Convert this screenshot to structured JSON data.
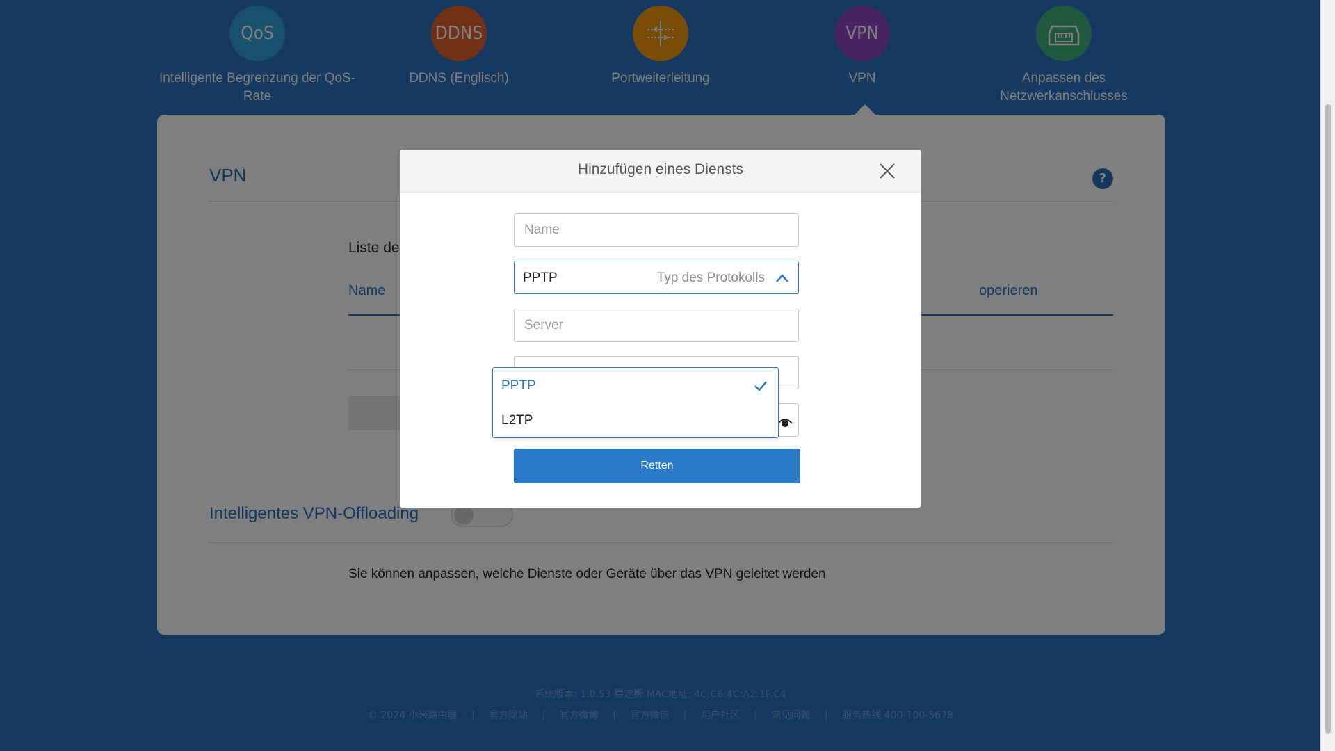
{
  "features": [
    {
      "icon_text": "QoS",
      "label": "Intelligente Begrenzung der QoS-Rate",
      "color": "#2fa3d6"
    },
    {
      "icon_text": "DDNS",
      "label": "DDNS (Englisch)",
      "color": "#e2622c"
    },
    {
      "icon_text": "",
      "icon": "port-forwarding-icon",
      "label": "Portweiterleitung",
      "color": "#f39a10"
    },
    {
      "icon_text": "VPN",
      "label": "VPN",
      "color": "#8f49c8"
    },
    {
      "icon_text": "",
      "icon": "network-port-icon",
      "label": "Anpassen des Netzwerkanschlusses",
      "color": "#3db07a"
    }
  ],
  "panel": {
    "title": "VPN",
    "list_heading": "Liste de",
    "col_name": "Name",
    "col_operate": "operieren",
    "offload_title": "Intelligentes VPN-Offloading",
    "offload_desc": "Sie können anpassen, welche Dienste oder Geräte über das VPN geleitet werden",
    "help_icon": "question-icon"
  },
  "modal": {
    "title": "Hinzufügen eines Diensts",
    "name_placeholder": "Name",
    "protocol_value": "PPTP",
    "protocol_hint": "Typ des Protokolls",
    "server_placeholder": "Server",
    "save_label": "Retten",
    "dropdown": {
      "options": [
        "PPTP",
        "L2TP"
      ],
      "selected": "PPTP"
    }
  },
  "footer": {
    "line1": "系统版本: 1.0.53 稳定版  MAC地址: 4C:C6:4C:A2:1F:C4",
    "copyright": "© 2024 小米路由器",
    "links": [
      "官方网站",
      "官方微博",
      "官方微信",
      "用户社区",
      "常见问题",
      "服务热线 400-100-5678"
    ]
  },
  "colors": {
    "background": "#2a73c2",
    "accent": "#2a78c8",
    "link": "#2a6fb8"
  }
}
